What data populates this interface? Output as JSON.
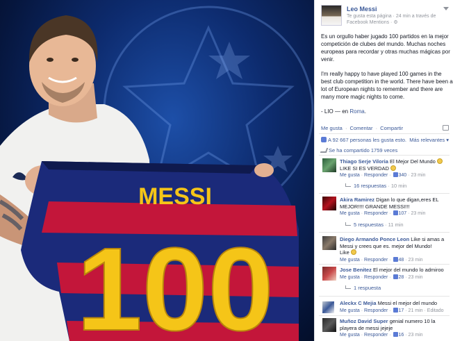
{
  "photo": {
    "jersey_name": "MESSI",
    "jersey_number": "100",
    "colors": {
      "background": "#0d2b6e",
      "jersey_blue": "#1b2a7a",
      "jersey_red": "#c3163a",
      "number_yellow": "#f5c518"
    }
  },
  "post": {
    "author": "Leo Messi",
    "meta_line1": "Te gusta esta página · 24 min a través de",
    "meta_line2": "Facebook Mentions · ",
    "paragraph_es": "Es un orgullo haber jugado 100 partidos en la mejor competición de clubes del mundo. Muchas noches europeas para recordar y otras muchas mágicas por venir.",
    "paragraph_en": "I'm really happy to have played 100 games in the best club competition in the world. There have been a lot of European nights to remember and there are many more magic nights to come.",
    "signoff": "- LIO — en ",
    "location": "Roma",
    "actions": {
      "like": "Me gusta",
      "comment": "Comentar",
      "share": "Compartir"
    },
    "likes_text": "A 92 667 personas les gusta esto.",
    "relevant_label": "Más relevantes",
    "shares_text": "Se ha compartido 1759 veces"
  },
  "comments": [
    {
      "name": "Thiago Serje Viloria",
      "text": "El Mejor Del Mundo",
      "text2": "LIKE SI ES VERDAD",
      "like": "Me gusta",
      "reply": "Responder",
      "count": "340",
      "time": "23 min",
      "replies": "16 respuestas",
      "replies_time": "10 min"
    },
    {
      "name": "Akira Ramirez",
      "text": "Digan lo que digan,eres EL",
      "text2": "MEJOR!!!! GRANDE MESSI!!!",
      "like": "Me gusta",
      "reply": "Responder",
      "count": "107",
      "time": "23 min",
      "replies": "5 respuestas",
      "replies_time": "11 min"
    },
    {
      "name": "Diego Armando Ponce Leon",
      "text": "Like si amas a",
      "text2": "Messi y crees que es. mejor del Mundo!",
      "text3": "Like",
      "like": "Me gusta",
      "reply": "Responder",
      "count": "48",
      "time": "23 min"
    },
    {
      "name": "Jose Benitez",
      "text": "El mejor del mundo lo admiroo",
      "like": "Me gusta",
      "reply": "Responder",
      "count": "28",
      "time": "23 min",
      "replies": "1 respuesta"
    },
    {
      "name": "Aleckx C Mejia",
      "text": "Messi el mejor del mundo",
      "like": "Me gusta",
      "reply": "Responder",
      "count": "17",
      "time": "21 min",
      "edited": "Editado"
    },
    {
      "name": "Muñoz David Super",
      "text": "genial numero 10 la",
      "text2": "playera de messi jejeje",
      "like": "Me gusta",
      "reply": "Responder",
      "count": "16",
      "time": "23 min"
    }
  ]
}
